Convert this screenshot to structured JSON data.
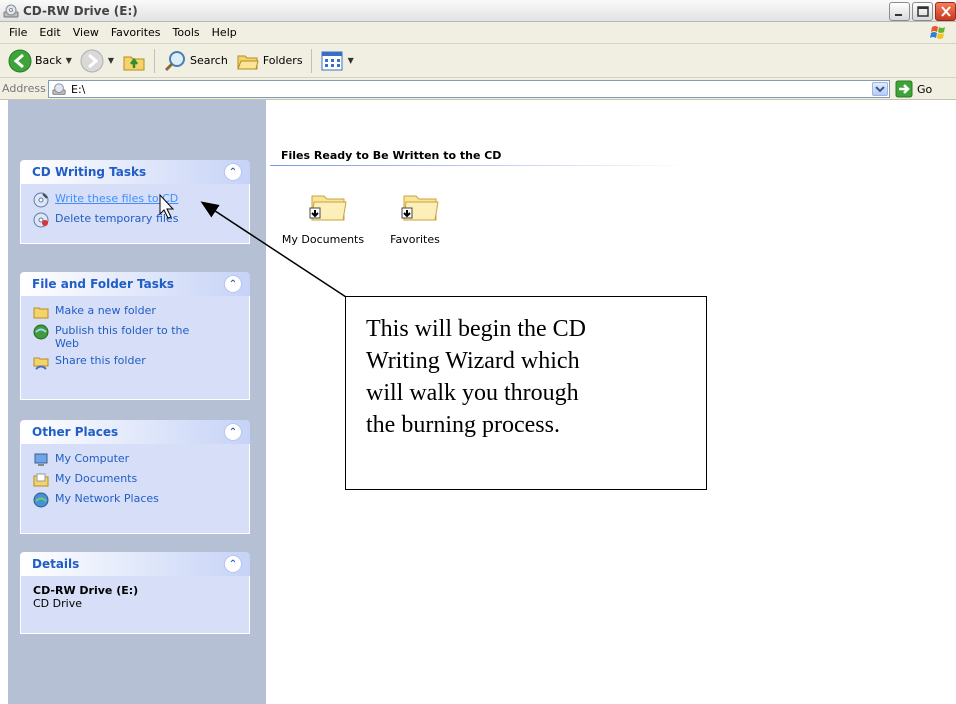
{
  "window": {
    "title": "CD-RW Drive (E:)"
  },
  "menu": [
    "File",
    "Edit",
    "View",
    "Favorites",
    "Tools",
    "Help"
  ],
  "toolbar": {
    "back": "Back",
    "search": "Search",
    "folders": "Folders"
  },
  "address": {
    "label": "Address",
    "value": "E:\\",
    "go": "Go"
  },
  "panels": {
    "cd_writing": {
      "title": "CD Writing Tasks",
      "tasks": [
        "Write these files to CD",
        "Delete temporary files"
      ]
    },
    "file_folder": {
      "title": "File and Folder Tasks",
      "tasks": [
        "Make a new folder",
        "Publish this folder to the Web",
        "Share this folder"
      ]
    },
    "other_places": {
      "title": "Other Places",
      "tasks": [
        "My Computer",
        "My Documents",
        "My Network Places"
      ]
    },
    "details": {
      "title": "Details",
      "name": "CD-RW Drive (E:)",
      "type": "CD Drive"
    }
  },
  "content": {
    "heading": "Files Ready to Be Written to the CD",
    "files": [
      "My Documents",
      "Favorites"
    ]
  },
  "callout": {
    "lines": [
      "This will begin the CD",
      "Writing Wizard which",
      "will walk you through",
      "the burning process."
    ]
  }
}
